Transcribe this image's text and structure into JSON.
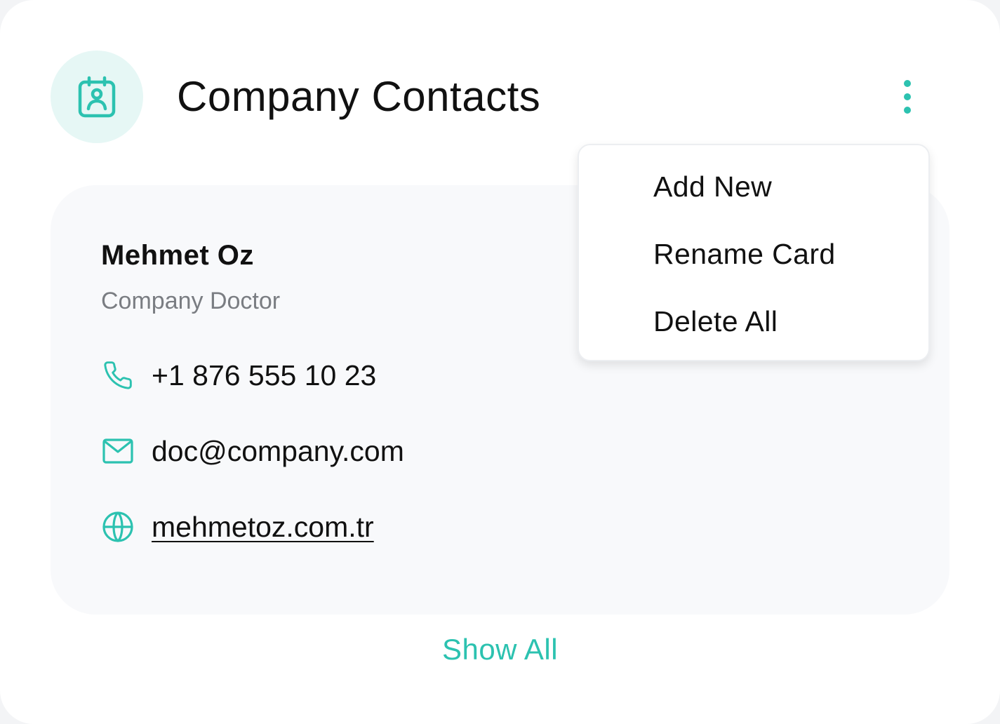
{
  "colors": {
    "accent": "#2cc2b0",
    "icon_bg": "#e6f7f5",
    "contact_bg": "#f8f9fb",
    "text_primary": "#111111",
    "text_secondary": "#7a7d82"
  },
  "header": {
    "icon": "contact-card-icon",
    "title": "Company Contacts",
    "more_icon": "more-vertical-icon"
  },
  "menu": {
    "items": [
      {
        "label": "Add New"
      },
      {
        "label": "Rename Card"
      },
      {
        "label": "Delete All"
      }
    ]
  },
  "contact": {
    "name": "Mehmet Oz",
    "role": "Company Doctor",
    "phone": {
      "icon": "phone-icon",
      "value": "+1 876 555 10 23"
    },
    "email": {
      "icon": "mail-icon",
      "value": "doc@company.com"
    },
    "website": {
      "icon": "globe-icon",
      "value": "mehmetoz.com.tr"
    }
  },
  "footer": {
    "show_all_label": "Show All"
  }
}
